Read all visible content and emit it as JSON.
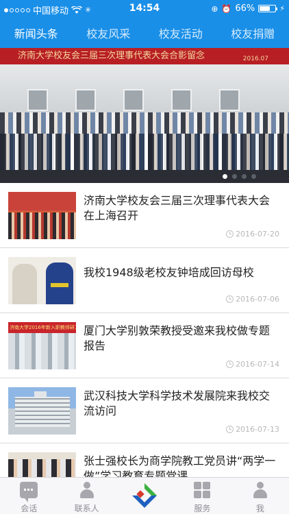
{
  "status_bar": {
    "carrier": "中国移动",
    "time": "14:54",
    "battery_percent": "66%",
    "battery_level": 0.66,
    "signal_bars": 1
  },
  "top_tabs": [
    {
      "label": "新闻头条",
      "active": true
    },
    {
      "label": "校友风采",
      "active": false
    },
    {
      "label": "校友活动",
      "active": false
    },
    {
      "label": "校友捐赠",
      "active": false
    }
  ],
  "banner": {
    "sign_text": "济南大学校友会三届三次理事代表大会合影留念",
    "sign_date": "2016.07",
    "pages": 4,
    "active_page": 1
  },
  "news": [
    {
      "title": "济南大学校友会三届三次理事代表大会在上海召开",
      "date": "2016-07-20",
      "thumb": "meeting-hall"
    },
    {
      "title": "我校1948级老校友钟培成回访母校",
      "date": "2016-07-06",
      "thumb": "alumni-visit"
    },
    {
      "title": "厦门大学别敦荣教授受邀来我校做专题报告",
      "date": "2016-07-14",
      "thumb": "lecture-room",
      "thumb_text": "济南大学2016年新入职教师研习营"
    },
    {
      "title": "武汉科技大学科学技术发展院来我校交流访问",
      "date": "2016-07-13",
      "thumb": "campus-building"
    },
    {
      "title": "张士强校长为商学院教工党员讲“两学一做”学习教育专题党课",
      "date": "",
      "thumb": "party-lecture"
    }
  ],
  "bottom_tabs": [
    {
      "label": "会话",
      "icon": "chat-icon"
    },
    {
      "label": "联系人",
      "icon": "contacts-icon"
    },
    {
      "label": "",
      "icon": "app-logo-icon"
    },
    {
      "label": "服务",
      "icon": "services-grid-icon"
    },
    {
      "label": "我",
      "icon": "me-icon"
    }
  ],
  "colors": {
    "primary": "#1a8fe8",
    "tab_inactive": "#d6ecfc",
    "logo_green": "#3cb040",
    "logo_blue": "#1f5fbf",
    "logo_red": "#d63a2c"
  }
}
